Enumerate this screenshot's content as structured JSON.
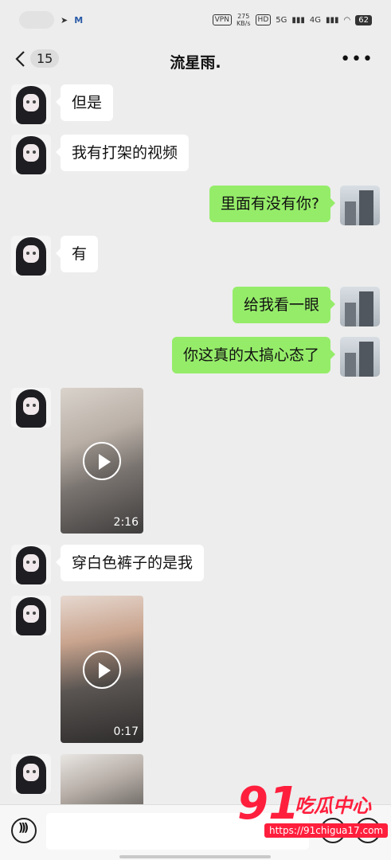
{
  "status_bar": {
    "vpn": "VPN",
    "speed_value": "275",
    "speed_unit": "KB/s",
    "hd": "HD",
    "network_1": "5G",
    "network_2": "4G",
    "battery": "62"
  },
  "header": {
    "unread_count": "15",
    "title": "流星雨."
  },
  "messages": [
    {
      "side": "left",
      "type": "text",
      "text": "但是"
    },
    {
      "side": "left",
      "type": "text",
      "text": "我有打架的视频"
    },
    {
      "side": "right",
      "type": "text",
      "text": "里面有没有你?"
    },
    {
      "side": "left",
      "type": "text",
      "text": "有"
    },
    {
      "side": "right",
      "type": "text",
      "text": "给我看一眼"
    },
    {
      "side": "right",
      "type": "text",
      "text": "你这真的太搞心态了"
    },
    {
      "side": "left",
      "type": "video",
      "duration": "2:16"
    },
    {
      "side": "left",
      "type": "text",
      "text": "穿白色裤子的是我"
    },
    {
      "side": "left",
      "type": "video",
      "duration": "0:17"
    },
    {
      "side": "left",
      "type": "video",
      "duration": ""
    }
  ],
  "watermark": {
    "number": "91",
    "text": "吃瓜中心",
    "url": "https://91chigua17.com"
  },
  "colors": {
    "background": "#ededed",
    "sent_bubble": "#95ec69",
    "received_bubble": "#ffffff",
    "watermark_red": "#ff1f3d"
  },
  "icons": {
    "back": "chevron-left-icon",
    "more": "more-dots-icon",
    "voice": "voice-icon",
    "emoji": "emoji-icon",
    "plus": "plus-icon",
    "play": "play-icon"
  }
}
